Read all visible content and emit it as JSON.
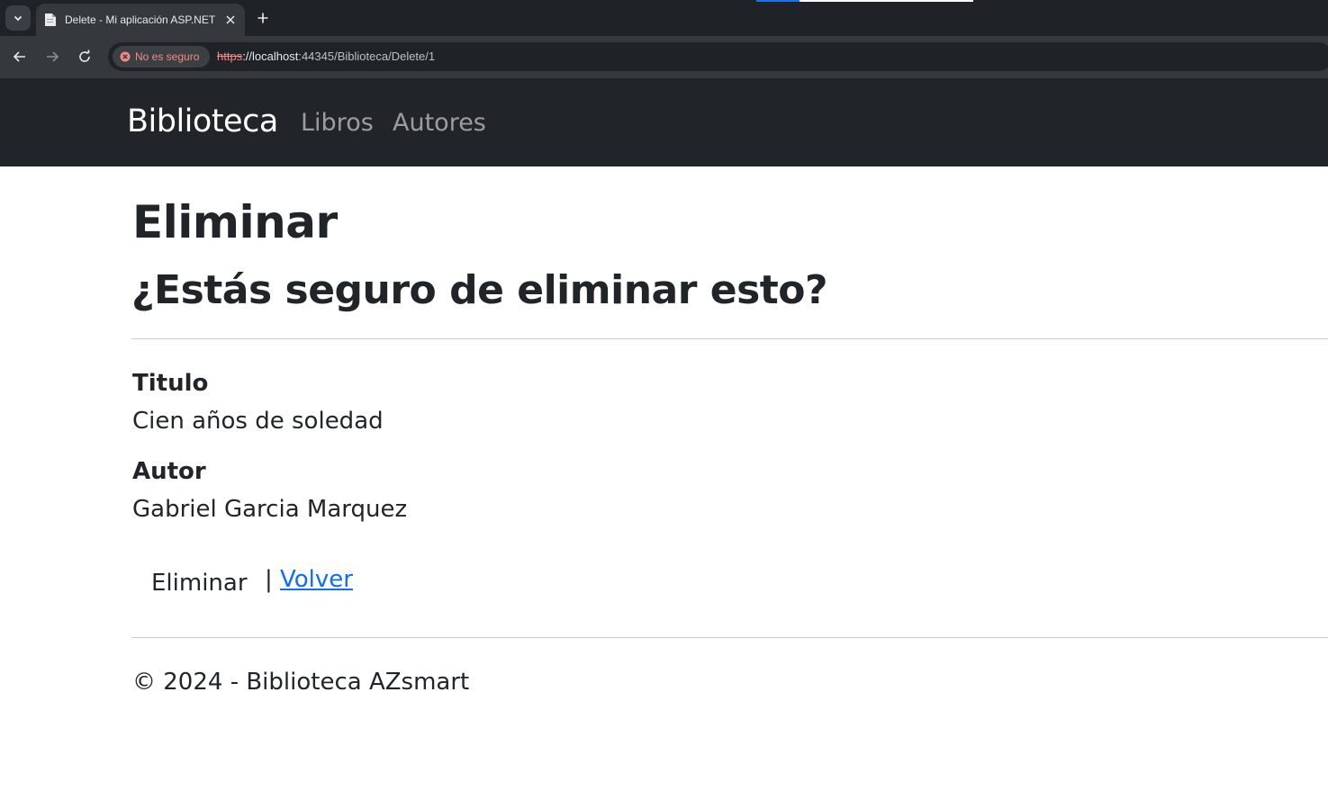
{
  "browser": {
    "tab_title": "Delete - Mi aplicación ASP.NET",
    "security_label": "No es seguro",
    "url_scheme": "https",
    "url_host": "://localhost",
    "url_path": ":44345/Biblioteca/Delete/1"
  },
  "navbar": {
    "brand": "Biblioteca",
    "links": [
      "Libros",
      "Autores"
    ]
  },
  "page": {
    "title": "Eliminar",
    "question": "¿Estás seguro de eliminar esto?",
    "fields": [
      {
        "label": "Titulo",
        "value": "Cien años de soledad"
      },
      {
        "label": "Autor",
        "value": "Gabriel Garcia Marquez"
      }
    ],
    "delete_button": "Eliminar",
    "separator": "|",
    "back_link": "Volver"
  },
  "footer": {
    "text": "© 2024 - Biblioteca AZsmart"
  },
  "colors": {
    "navbar_bg": "#212529",
    "link": "#0d6efd",
    "insecure": "#f28b82"
  }
}
